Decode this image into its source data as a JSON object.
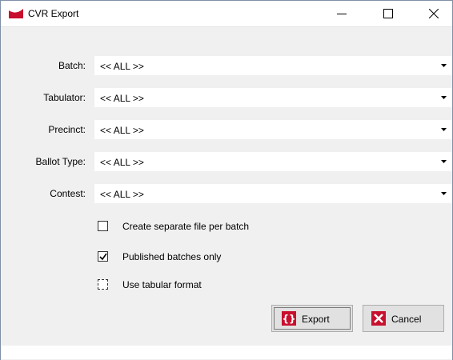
{
  "window": {
    "title": "CVR Export"
  },
  "fields": [
    {
      "label": "Batch:",
      "value": "<< ALL >>"
    },
    {
      "label": "Tabulator:",
      "value": "<< ALL >>"
    },
    {
      "label": "Precinct:",
      "value": "<< ALL >>"
    },
    {
      "label": "Ballot Type:",
      "value": "<< ALL >>"
    },
    {
      "label": "Contest:",
      "value": "<< ALL >>"
    }
  ],
  "options": [
    {
      "label": "Create separate file per batch",
      "checked": false
    },
    {
      "label": "Published batches only",
      "checked": true
    },
    {
      "label": "Use tabular format",
      "checked": false
    }
  ],
  "buttons": {
    "export_label": "Export",
    "cancel_label": "Cancel"
  },
  "colors": {
    "icon_red": "#c8102e",
    "dialog_bg": "#f0f0f0"
  }
}
